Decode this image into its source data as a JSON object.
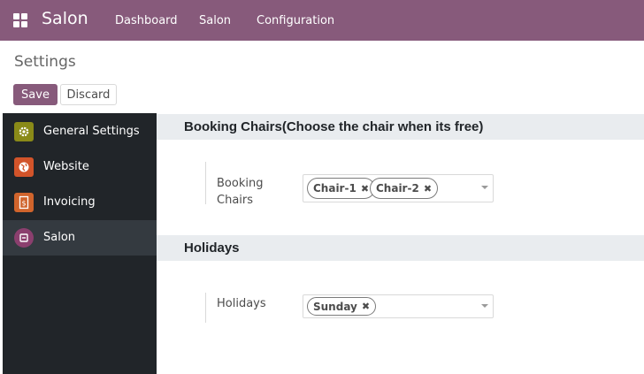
{
  "navbar": {
    "brand": "Salon",
    "items": [
      "Dashboard",
      "Salon",
      "Configuration"
    ]
  },
  "page": {
    "title": "Settings",
    "save_label": "Save",
    "discard_label": "Discard"
  },
  "sidebar": {
    "items": [
      {
        "label": "General Settings",
        "icon": "gear-icon",
        "color": "#8a8a18"
      },
      {
        "label": "Website",
        "icon": "globe-icon",
        "color": "#d2542a"
      },
      {
        "label": "Invoicing",
        "icon": "invoice-icon",
        "color": "#d0642c"
      },
      {
        "label": "Salon",
        "icon": "salon-icon",
        "color": "#8b3f6e",
        "active": true
      }
    ]
  },
  "sections": [
    {
      "title": "Booking Chairs(Choose the chair when its free)",
      "setting_label_lines": [
        "Booking",
        "Chairs"
      ],
      "tags": [
        "Chair-1",
        "Chair-2"
      ]
    },
    {
      "title": "Holidays",
      "setting_label_lines": [
        "Holidays"
      ],
      "tags": [
        "Sunday"
      ]
    }
  ],
  "colors": {
    "navbar": "#875a7b",
    "sidebar": "#212529",
    "section_header": "#e9ecef"
  }
}
